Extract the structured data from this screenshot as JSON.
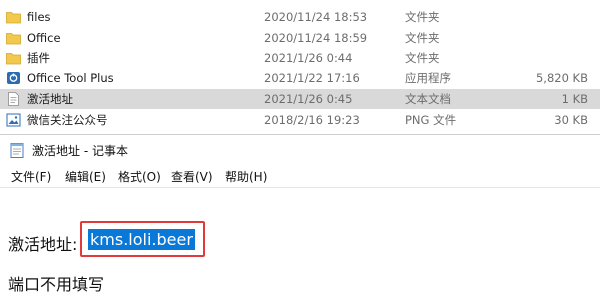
{
  "explorer": {
    "files": [
      {
        "name": "files",
        "date": "2020/11/24 18:53",
        "type": "文件夹",
        "size": "",
        "icon": "folder-icon",
        "selected": false
      },
      {
        "name": "Office",
        "date": "2020/11/24 18:59",
        "type": "文件夹",
        "size": "",
        "icon": "folder-icon",
        "selected": false
      },
      {
        "name": "插件",
        "date": "2021/1/26 0:44",
        "type": "文件夹",
        "size": "",
        "icon": "folder-icon",
        "selected": false
      },
      {
        "name": "Office Tool Plus",
        "date": "2021/1/22 17:16",
        "type": "应用程序",
        "size": "5,820 KB",
        "icon": "app-icon",
        "selected": false
      },
      {
        "name": "激活地址",
        "date": "2021/1/26 0:45",
        "type": "文本文档",
        "size": "1 KB",
        "icon": "text-document-icon",
        "selected": true
      },
      {
        "name": "微信关注公众号",
        "date": "2018/2/16 19:23",
        "type": "PNG 文件",
        "size": "30 KB",
        "icon": "image-file-icon",
        "selected": false
      }
    ]
  },
  "notepad": {
    "title": "激活地址 - 记事本",
    "menu": [
      "文件(F)",
      "编辑(E)",
      "格式(O)",
      "查看(V)",
      "帮助(H)"
    ],
    "content": {
      "label": "激活地址:",
      "selected_text": "kms.loli.beer",
      "line2": "端口不用填写"
    }
  },
  "colors": {
    "selection": "#0a78d7",
    "highlight_box": "#e03a3a",
    "folder": "#f2c94c",
    "row_selected": "#d9d9d9"
  }
}
